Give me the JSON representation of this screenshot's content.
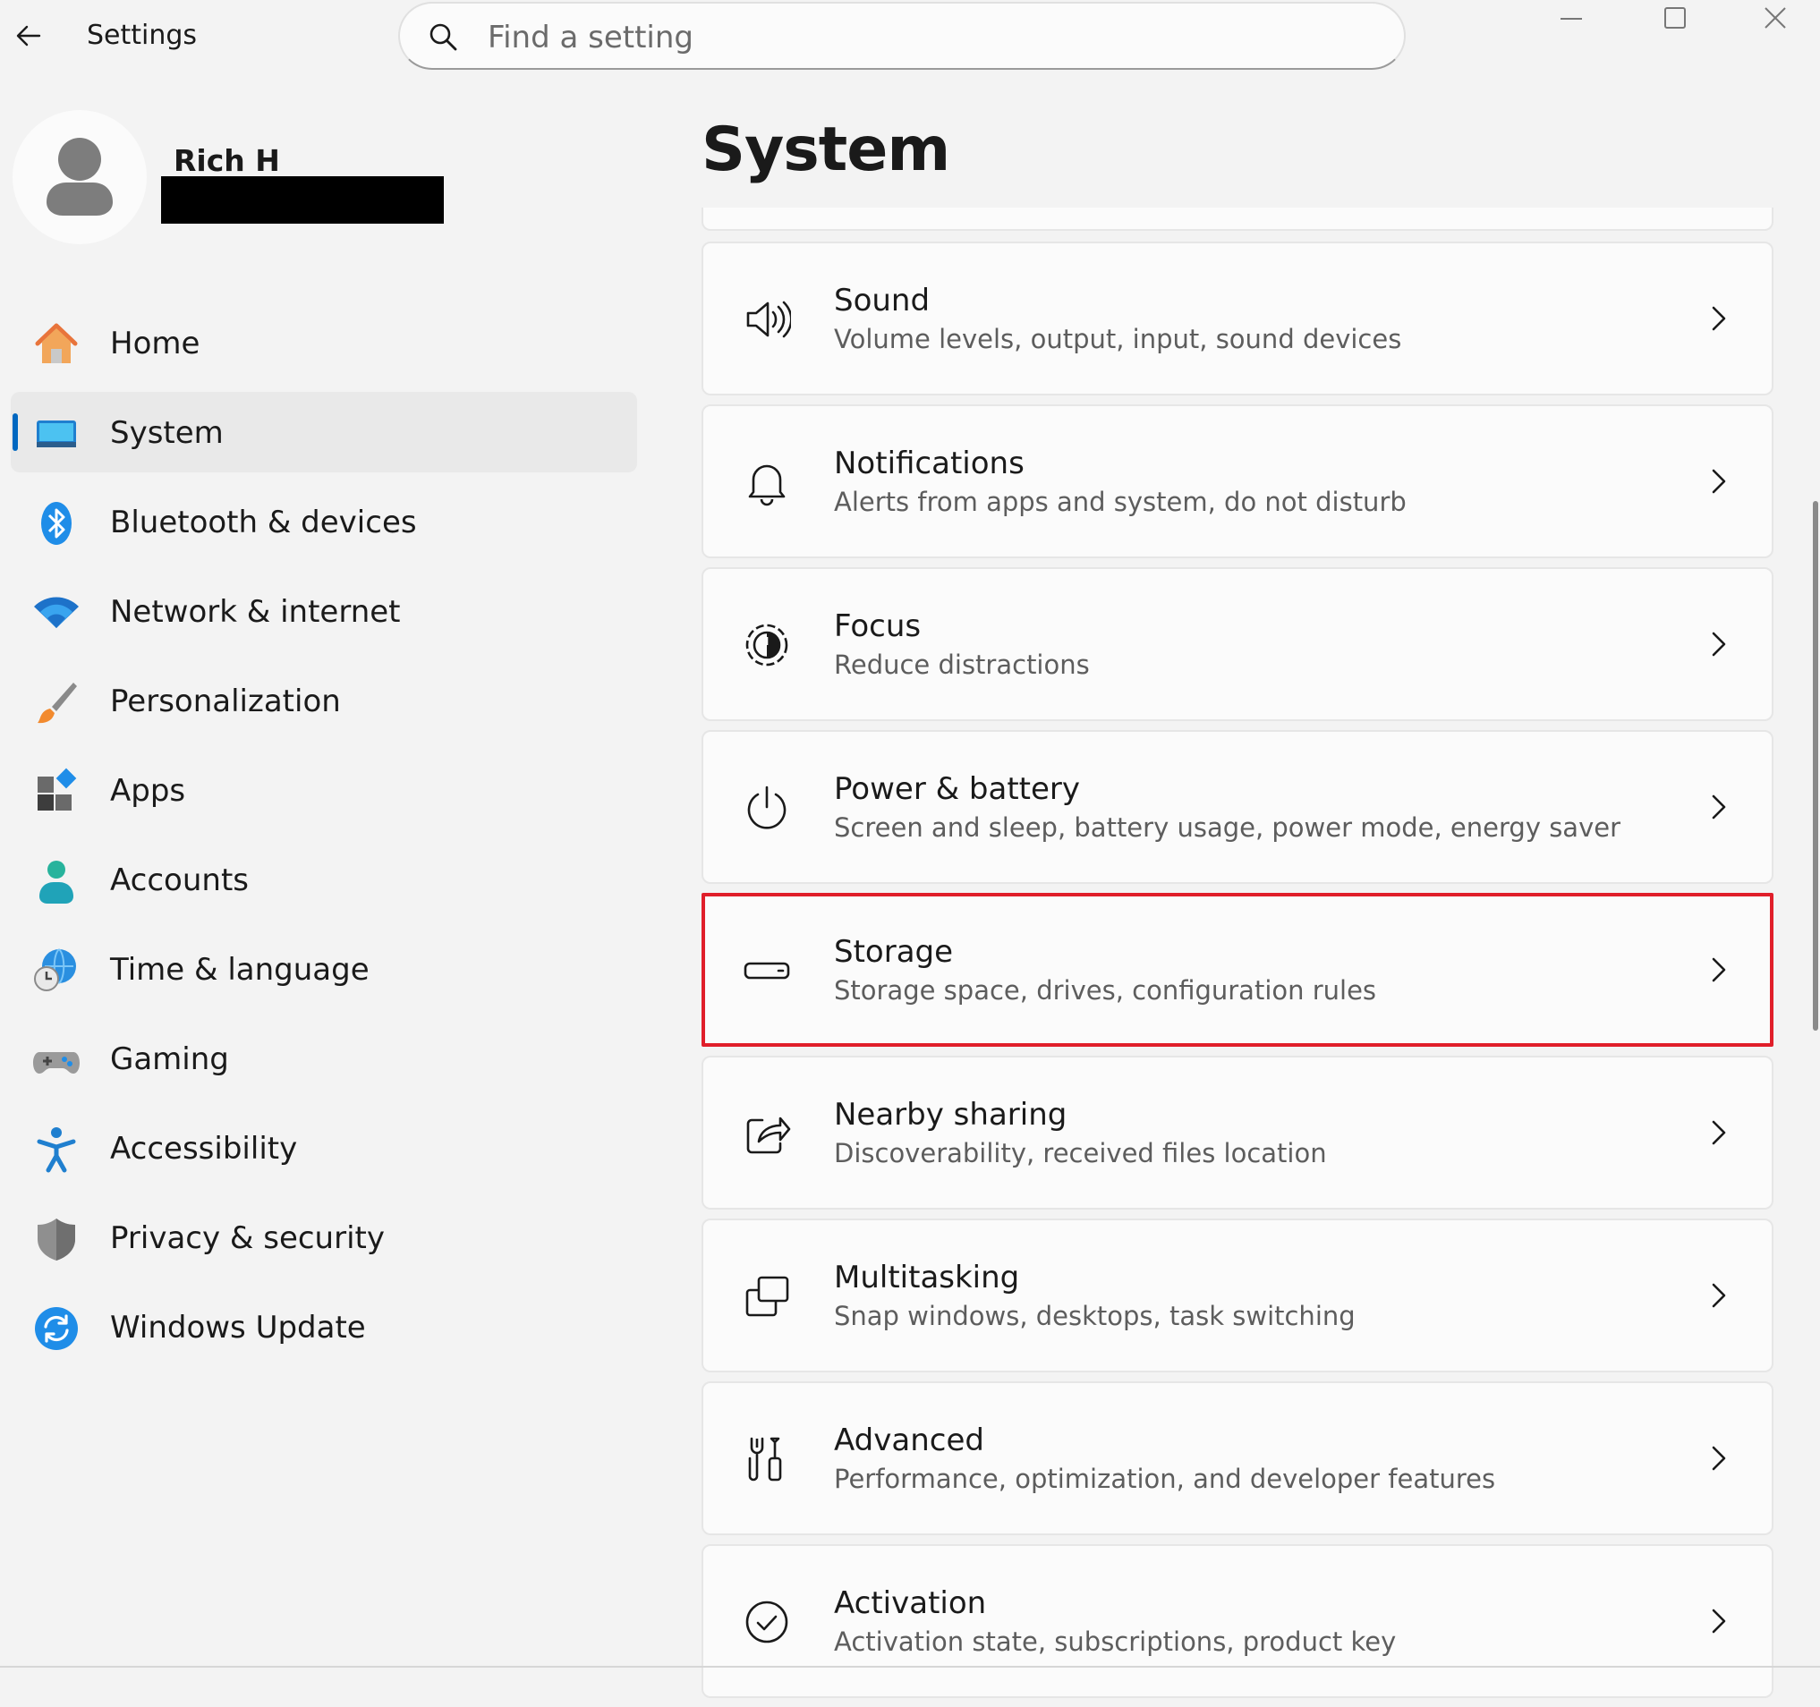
{
  "window": {
    "title": "Settings",
    "controls": [
      "minimize",
      "maximize",
      "close"
    ]
  },
  "search": {
    "placeholder": "Find a setting",
    "value": ""
  },
  "profile": {
    "name": "Rich H",
    "email_redacted": true
  },
  "nav": {
    "items": [
      {
        "label": "Home",
        "icon": "home-icon",
        "selected": false
      },
      {
        "label": "System",
        "icon": "system-icon",
        "selected": true
      },
      {
        "label": "Bluetooth & devices",
        "icon": "bluetooth-icon",
        "selected": false
      },
      {
        "label": "Network & internet",
        "icon": "wifi-icon",
        "selected": false
      },
      {
        "label": "Personalization",
        "icon": "brush-icon",
        "selected": false
      },
      {
        "label": "Apps",
        "icon": "apps-icon",
        "selected": false
      },
      {
        "label": "Accounts",
        "icon": "accounts-icon",
        "selected": false
      },
      {
        "label": "Time & language",
        "icon": "globe-clock-icon",
        "selected": false
      },
      {
        "label": "Gaming",
        "icon": "gamepad-icon",
        "selected": false
      },
      {
        "label": "Accessibility",
        "icon": "accessibility-icon",
        "selected": false
      },
      {
        "label": "Privacy & security",
        "icon": "shield-icon",
        "selected": false
      },
      {
        "label": "Windows Update",
        "icon": "update-icon",
        "selected": false
      }
    ]
  },
  "main": {
    "title": "System",
    "cards": [
      {
        "title": "Sound",
        "subtitle": "Volume levels, output, input, sound devices",
        "icon": "speaker-icon"
      },
      {
        "title": "Notifications",
        "subtitle": "Alerts from apps and system, do not disturb",
        "icon": "bell-icon"
      },
      {
        "title": "Focus",
        "subtitle": "Reduce distractions",
        "icon": "focus-icon"
      },
      {
        "title": "Power & battery",
        "subtitle": "Screen and sleep, battery usage, power mode, energy saver",
        "icon": "power-icon"
      },
      {
        "title": "Storage",
        "subtitle": "Storage space, drives, configuration rules",
        "icon": "storage-icon",
        "highlighted": true
      },
      {
        "title": "Nearby sharing",
        "subtitle": "Discoverability, received files location",
        "icon": "share-icon"
      },
      {
        "title": "Multitasking",
        "subtitle": "Snap windows, desktops, task switching",
        "icon": "multitasking-icon"
      },
      {
        "title": "Advanced",
        "subtitle": "Performance, optimization, and developer features",
        "icon": "tools-icon"
      },
      {
        "title": "Activation",
        "subtitle": "Activation state, subscriptions, product key",
        "icon": "checkmark-circle-icon"
      }
    ]
  },
  "colors": {
    "accent": "#0067c0",
    "highlight_border": "#e01e2a",
    "background": "#f3f3f3",
    "card": "#fbfbfb"
  }
}
